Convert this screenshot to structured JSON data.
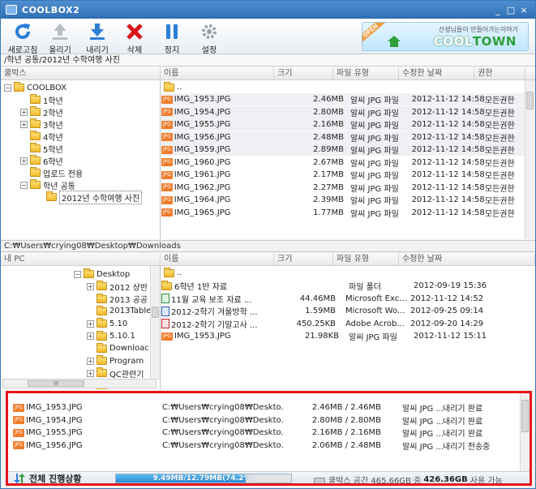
{
  "window": {
    "title": "COOLBOX2",
    "minimize": "_",
    "maximize": "□",
    "close": "×"
  },
  "toolbar": {
    "buttons": [
      {
        "label": "새로고침",
        "icon": "refresh-icon"
      },
      {
        "label": "올리기",
        "icon": "upload-icon"
      },
      {
        "label": "내리기",
        "icon": "download-icon"
      },
      {
        "label": "삭제",
        "icon": "delete-icon"
      },
      {
        "label": "정지",
        "icon": "pause-icon"
      },
      {
        "label": "설정",
        "icon": "gear-icon"
      }
    ],
    "banner": {
      "tag": "OPEN",
      "slogan": "선생님들이 만들어가는이야기",
      "brand_a": "COOL",
      "brand_b": "TOWN"
    }
  },
  "remote": {
    "path": "/학년 공통/2012년 수학여행 사진",
    "tree_header": "쿨박스",
    "columns": [
      "이름",
      "크기",
      "파일 유형",
      "수정한 날짜",
      "권한"
    ],
    "tree": [
      {
        "label": "COOLBOX",
        "level": 0,
        "expander": "-"
      },
      {
        "label": "1학년",
        "level": 1,
        "expander": ""
      },
      {
        "label": "2학년",
        "level": 1,
        "expander": "+"
      },
      {
        "label": "3학년",
        "level": 1,
        "expander": "+"
      },
      {
        "label": "4학년",
        "level": 1,
        "expander": ""
      },
      {
        "label": "5학년",
        "level": 1,
        "expander": ""
      },
      {
        "label": "6학년",
        "level": 1,
        "expander": "+"
      },
      {
        "label": "업로드 전용",
        "level": 1,
        "expander": ""
      },
      {
        "label": "학년 공통",
        "level": 1,
        "expander": "-"
      },
      {
        "label": "2012년 수학여행 사진",
        "level": 2,
        "expander": "",
        "selected": true
      }
    ],
    "parent_label": "..",
    "files": [
      {
        "name": "IMG_1953.JPG",
        "size": "2.46MB",
        "type": "알씨 JPG 파일",
        "date": "2012-11-12 14:58",
        "perm": "모든권한",
        "hl": true
      },
      {
        "name": "IMG_1954.JPG",
        "size": "2.80MB",
        "type": "알씨 JPG 파일",
        "date": "2012-11-12 14:58",
        "perm": "모든권한",
        "hl": true
      },
      {
        "name": "IMG_1955.JPG",
        "size": "2.16MB",
        "type": "알씨 JPG 파일",
        "date": "2012-11-12 14:58",
        "perm": "모든권한",
        "hl": true
      },
      {
        "name": "IMG_1956.JPG",
        "size": "2.48MB",
        "type": "알씨 JPG 파일",
        "date": "2012-11-12 14:58",
        "perm": "모든권한",
        "hl": true
      },
      {
        "name": "IMG_1959.JPG",
        "size": "2.89MB",
        "type": "알씨 JPG 파일",
        "date": "2012-11-12 14:58",
        "perm": "모든권한",
        "hl": true
      },
      {
        "name": "IMG_1960.JPG",
        "size": "2.67MB",
        "type": "알씨 JPG 파일",
        "date": "2012-11-12 14:58",
        "perm": "모든권한"
      },
      {
        "name": "IMG_1961.JPG",
        "size": "2.17MB",
        "type": "알씨 JPG 파일",
        "date": "2012-11-12 14:58",
        "perm": "모든권한"
      },
      {
        "name": "IMG_1962.JPG",
        "size": "2.27MB",
        "type": "알씨 JPG 파일",
        "date": "2012-11-12 14:58",
        "perm": "모든권한"
      },
      {
        "name": "IMG_1964.JPG",
        "size": "2.39MB",
        "type": "알씨 JPG 파일",
        "date": "2012-11-12 14:58",
        "perm": "모든권한"
      },
      {
        "name": "IMG_1965.JPG",
        "size": "1.77MB",
        "type": "알씨 JPG 파일",
        "date": "2012-11-12 14:58",
        "perm": "모든권한"
      }
    ]
  },
  "local": {
    "path": "C:₩Users₩crying08₩Desktop₩Downloads",
    "tree_header": "내 PC",
    "columns": [
      "이름",
      "크기",
      "파일 유형",
      "수정한 날짜"
    ],
    "tree": [
      {
        "label": "Desktop",
        "level": 0,
        "expander": "-"
      },
      {
        "label": "2012 상반",
        "level": 1,
        "expander": "+"
      },
      {
        "label": "2013 공공",
        "level": 1,
        "expander": ""
      },
      {
        "label": "2013Table",
        "level": 1,
        "expander": ""
      },
      {
        "label": "5.10",
        "level": 1,
        "expander": "+"
      },
      {
        "label": "5.10.1",
        "level": 1,
        "expander": "+"
      },
      {
        "label": "Downloac",
        "level": 1,
        "expander": ""
      },
      {
        "label": "Program",
        "level": 1,
        "expander": "+"
      },
      {
        "label": "QC관련기",
        "level": 1,
        "expander": "+"
      },
      {
        "label": "WebLinkD",
        "level": 1,
        "expander": ""
      }
    ],
    "tree_hscroll_thumb": "III",
    "parent_label": "..",
    "files": [
      {
        "name": "6학년 1반 자료",
        "size": "",
        "type": "파일 폴더",
        "date": "2012-09-19 15:36",
        "kind": "folder"
      },
      {
        "name": "11월 교육 보조 자료 ...",
        "size": "44.46MB",
        "type": "Microsoft Exc...",
        "date": "2012-11-12 14:52",
        "kind": "xls"
      },
      {
        "name": "2012-2학기 겨울방학 ...",
        "size": "1.59MB",
        "type": "Microsoft Wo...",
        "date": "2012-09-25 09:14",
        "kind": "doc"
      },
      {
        "name": "2012-2학기 기말고사 ...",
        "size": "450.25KB",
        "type": "Adobe Acrob...",
        "date": "2012-09-20 14:29",
        "kind": "pdf"
      },
      {
        "name": "IMG_1953.JPG",
        "size": "21.98KB",
        "type": "알씨 JPG 파일",
        "date": "2012-11-12 15:11",
        "kind": "jpg"
      }
    ]
  },
  "transfers": {
    "columns": [
      "이름",
      "위치",
      "크기",
      "파일 유형",
      "전송상태"
    ],
    "rows": [
      {
        "name": "IMG_1953.JPG",
        "loc": "C:₩Users₩crying08₩Deskto...",
        "size": "2.46MB / 2.46MB",
        "type": "알씨 JPG ...",
        "status": "내리기 완료"
      },
      {
        "name": "IMG_1954.JPG",
        "loc": "C:₩Users₩crying08₩Deskto...",
        "size": "2.80MB / 2.80MB",
        "type": "알씨 JPG ...",
        "status": "내리기 완료"
      },
      {
        "name": "IMG_1955.JPG",
        "loc": "C:₩Users₩crying08₩Deskto...",
        "size": "2.16MB / 2.16MB",
        "type": "알씨 JPG ...",
        "status": "내리기 완료"
      },
      {
        "name": "IMG_1956.JPG",
        "loc": "C:₩Users₩crying08₩Deskto...",
        "size": "2.06MB / 2.48MB",
        "type": "알씨 JPG ...",
        "status": "내리기 전송중"
      }
    ],
    "overall_label": "전체 진행상황",
    "progress_text": "9.49MB/12.79MB(74.2%)",
    "progress_fraction": 0.742,
    "space_prefix": "쿨박스 공간 465.66GB 중",
    "space_used": "426.36GB",
    "space_suffix": "사용 가능"
  }
}
